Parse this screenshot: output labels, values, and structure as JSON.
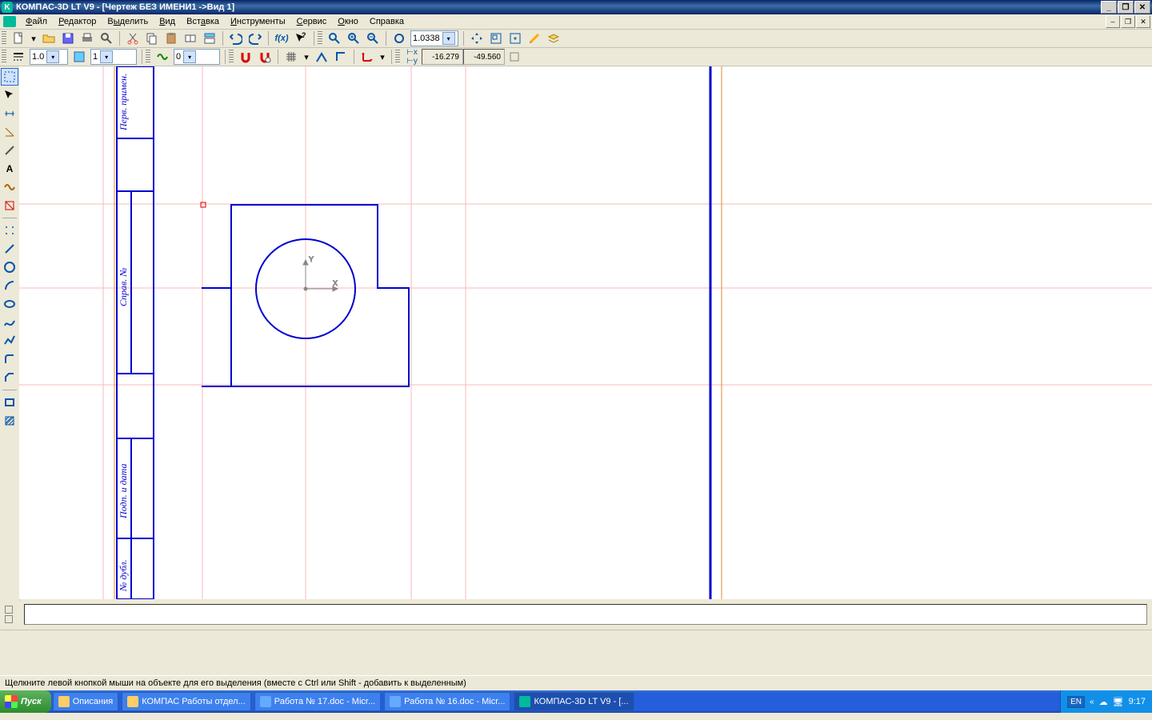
{
  "titlebar": {
    "text": "КОМПАС-3D LT V9 - [Чертеж БЕЗ ИМЕНИ1 ->Вид 1]"
  },
  "menus": {
    "file": "Файл",
    "edit": "Редактор",
    "select": "Выделить",
    "view": "Вид",
    "insert": "Вставка",
    "tools": "Инструменты",
    "service": "Сервис",
    "window": "Окно",
    "help": "Справка"
  },
  "tb1": {
    "zoom_value": "1.0338"
  },
  "tb2": {
    "line_width": "1.0",
    "layer": "1",
    "hatch": "0",
    "coord_x": "-16.279",
    "coord_y": "-49.560"
  },
  "canvas_labels": {
    "label1": "Перв. примен.",
    "label2": "Справ. №",
    "label3": "Подп. и дата",
    "label4": "№ дубл."
  },
  "status": {
    "text": "Щелкните левой кнопкой мыши на объекте для его выделения (вместе с Ctrl или Shift - добавить к выделенным)"
  },
  "taskbar": {
    "start": "Пуск",
    "items": [
      {
        "label": "Описания"
      },
      {
        "label": "КОМПАС Работы отдел..."
      },
      {
        "label": "Работа № 17.doc - Micr..."
      },
      {
        "label": "Работа № 16.doc - Micr..."
      },
      {
        "label": "КОМПАС-3D LT V9 - [..."
      }
    ],
    "lang": "EN",
    "time": "9:17"
  }
}
